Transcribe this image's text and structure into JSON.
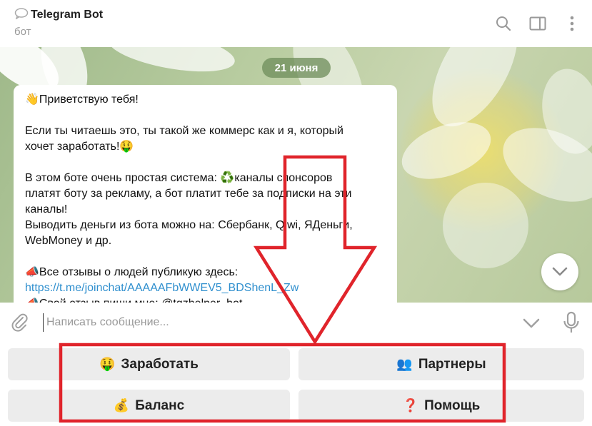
{
  "header": {
    "title": "Telegram Bot",
    "status": "бот",
    "icons": [
      "chat-bubble-icon",
      "search-icon",
      "sidebar-toggle-icon",
      "more-vertical-icon"
    ]
  },
  "chat": {
    "date": "21 июня",
    "message": {
      "lines": [
        "👋Приветствую тебя!",
        "",
        "Если ты читаешь это, ты такой же коммерс как и я, который",
        "хочет заработать!🤑",
        "",
        "В этом боте очень простая система: ♻️каналы спонсоров",
        "платят боту за рекламу, а бот платит тебе за подписки на эти",
        "каналы!",
        "Выводить деньги из бота можно на: Сбербанк, Qiwi, ЯДеньги,",
        "WebMoney и др.",
        "",
        "📣Все отзывы о людей публикую здесь:"
      ],
      "link": "https://t.me/joinchat/AAAAAFbWWEV5_BDShenL_Zw",
      "cut_line": "📣Свой отзыв пиши мне: @tgzhelper_bot"
    }
  },
  "composer": {
    "placeholder": "Написать сообщение..."
  },
  "keyboard": {
    "buttons": [
      {
        "emoji": "🤑",
        "label": "Заработать"
      },
      {
        "emoji": "👥",
        "label": "Партнеры"
      },
      {
        "emoji": "💰",
        "label": "Баланс"
      },
      {
        "emoji": "❓",
        "label": "Помощь"
      }
    ]
  },
  "colors": {
    "annotation": "#e0242b",
    "link": "#2f8fce",
    "date_pill": "#6e8c5a",
    "button_bg": "#ececec"
  }
}
